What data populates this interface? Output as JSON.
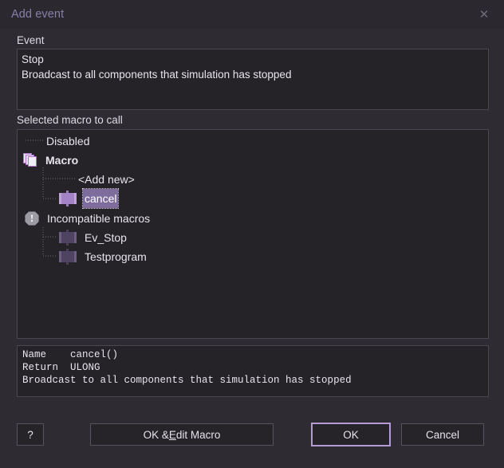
{
  "window": {
    "title": "Add event",
    "close_icon": "close-icon"
  },
  "event_section": {
    "label": "Event",
    "name_line": "Stop",
    "description_line": "Broadcast to all components that simulation has stopped"
  },
  "macro_section": {
    "label": "Selected macro to call",
    "tree": [
      {
        "id": "disabled",
        "label": "Disabled",
        "icon": "none",
        "indent": 1,
        "bold": false,
        "selected": false,
        "dim": false
      },
      {
        "id": "macro",
        "label": "Macro",
        "icon": "macro-stack",
        "indent": 0,
        "bold": true,
        "selected": false,
        "dim": false
      },
      {
        "id": "add-new",
        "label": "<Add new>",
        "icon": "none",
        "indent": 2,
        "bold": false,
        "selected": false,
        "dim": false
      },
      {
        "id": "cancel",
        "label": "cancel",
        "icon": "macro-block",
        "indent": 1,
        "bold": false,
        "selected": true,
        "dim": false
      },
      {
        "id": "incompatible",
        "label": "Incompatible macros",
        "icon": "warning",
        "indent": 0,
        "bold": false,
        "selected": false,
        "dim": false
      },
      {
        "id": "ev-stop",
        "label": "Ev_Stop",
        "icon": "macro-block",
        "indent": 1,
        "bold": false,
        "selected": false,
        "dim": true
      },
      {
        "id": "testprogram",
        "label": "Testprogram",
        "icon": "macro-block",
        "indent": 1,
        "bold": false,
        "selected": false,
        "dim": true
      }
    ]
  },
  "info_box": {
    "line_name": "Name    cancel()",
    "line_return": "Return  ULONG",
    "line_desc": "Broadcast to all components that simulation has stopped"
  },
  "buttons": {
    "help": "?",
    "edit_macro_pre": "OK & ",
    "edit_macro_accel": "E",
    "edit_macro_post": "dit Macro",
    "ok": "OK",
    "cancel": "Cancel"
  },
  "colors": {
    "window_bg": "#2e2b33",
    "titlebar_bg": "#2b292f",
    "title_text": "#8a7fa8",
    "panel_bg": "#252328",
    "panel_border": "#4a4751",
    "text": "#e8e6ec",
    "selection_bg": "#7e6c9c",
    "focus_border": "#b49bd6",
    "macro_accent": "#a482c6",
    "macro_dim": "#4e4360",
    "warning_gray": "#9c9aa2"
  }
}
